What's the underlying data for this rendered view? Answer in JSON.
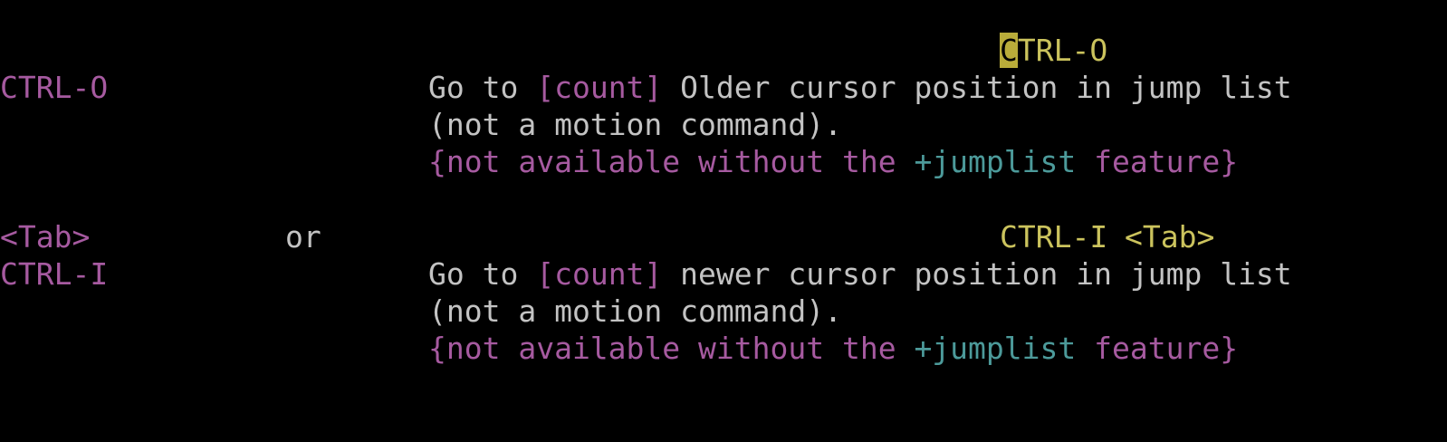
{
  "colors": {
    "background": "#000000",
    "normal_text": "#c3c3c3",
    "tag": "#cbc35d",
    "special": "#a65aa0",
    "option": "#4c9a9a",
    "cursor_bg": "#b9ac3a"
  },
  "entry1": {
    "tag_cursor_char": "C",
    "tag_rest": "TRL-O",
    "key": "CTRL-O",
    "desc1_a": "Go to ",
    "desc1_count": "[count]",
    "desc1_b": " Older cursor position in jump list",
    "desc2": "(not a motion command).",
    "note_a": "{not available without the ",
    "note_option": "+jumplist",
    "note_b": " feature}"
  },
  "entry2": {
    "key_tab": "<Tab>",
    "or": "or",
    "tag": "CTRL-I",
    "tag_tab": "<Tab>",
    "key": "CTRL-I",
    "desc1_a": "Go to ",
    "desc1_count": "[count]",
    "desc1_b": " newer cursor position in jump list",
    "desc2": "(not a motion command).",
    "note_a": "{not available without the ",
    "note_option": "+jumplist",
    "note_b": " feature}"
  }
}
